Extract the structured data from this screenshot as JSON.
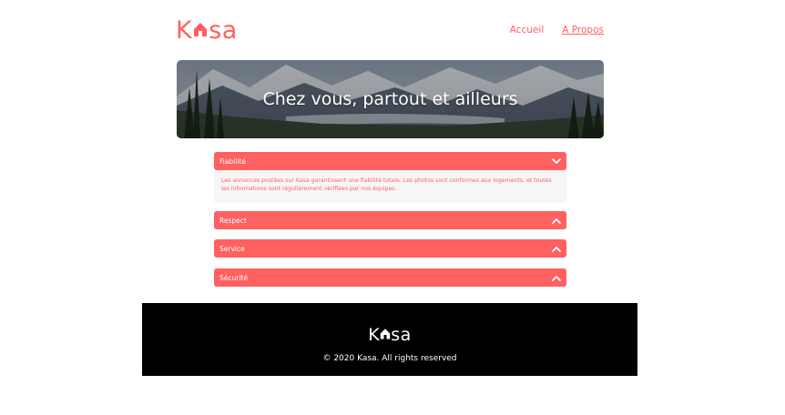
{
  "header": {
    "logo": {
      "letter_before": "K",
      "letters_after": "sa",
      "icon": "house-icon"
    },
    "nav": [
      {
        "label": "Accueil",
        "active": false
      },
      {
        "label": "A Propos",
        "active": true
      }
    ]
  },
  "banner": {
    "title": "Chez vous, partout et ailleurs"
  },
  "collapses": [
    {
      "title": "Fiabilité",
      "expanded": true,
      "icon": "chevron-down-icon",
      "body": "Les annonces postées sur Kasa garantissent une fiabilité totale. Les photos sont conformes aux logements, et toutes les informations sont régulièrement vérifiées par nos équipes."
    },
    {
      "title": "Respect",
      "expanded": false,
      "icon": "chevron-up-icon"
    },
    {
      "title": "Service",
      "expanded": false,
      "icon": "chevron-up-icon"
    },
    {
      "title": "Sécurité",
      "expanded": false,
      "icon": "chevron-up-icon"
    }
  ],
  "footer": {
    "logo": {
      "letter_before": "K",
      "letters_after": "sa",
      "icon": "house-icon"
    },
    "copyright": "© 2020 Kasa. All rights reserved"
  },
  "colors": {
    "brand": "#FF6060",
    "panel": "#F6F6F6",
    "footer_bg": "#000000"
  }
}
